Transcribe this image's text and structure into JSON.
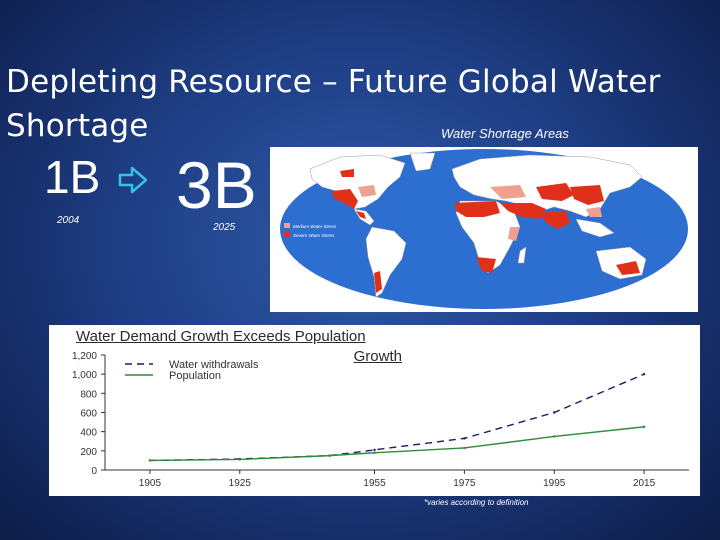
{
  "slide": {
    "title": "Depleting Resource – Future Global Water Shortage",
    "map_caption": "Water Shortage Areas",
    "stat_from": "1B",
    "stat_to": "3B",
    "year_from": "2004",
    "year_to": "2025",
    "footnote": "*varies according to definition"
  },
  "map": {
    "legend": [
      "Medium Water Stress",
      "Severe Water Stress"
    ],
    "colors": {
      "ocean": "#2d6fd0",
      "land": "#ffffff",
      "medium_stress": "#f0a090",
      "severe_stress": "#e0301a"
    }
  },
  "chart": {
    "heading_line1": "Water Demand Growth Exceeds Population",
    "heading_line2": "Growth"
  },
  "chart_data": {
    "type": "line",
    "title": "Water Demand Growth Exceeds Population Growth",
    "x": [
      1905,
      1925,
      1945,
      1955,
      1975,
      1995,
      2015
    ],
    "xticks": [
      "1905",
      "1925",
      "1955",
      "1975",
      "1995",
      "2015"
    ],
    "yticks": [
      "0",
      "200",
      "400",
      "600",
      "800",
      "1,000",
      "1,200"
    ],
    "ylim": [
      0,
      1200
    ],
    "series": [
      {
        "name": "Water withdrawals",
        "style": "dashed",
        "color": "#1a1a6a",
        "values": [
          100,
          115,
          150,
          210,
          330,
          600,
          1000
        ]
      },
      {
        "name": "Population",
        "style": "solid",
        "color": "#2e8b3a",
        "values": [
          100,
          110,
          150,
          180,
          230,
          350,
          450
        ]
      }
    ]
  }
}
